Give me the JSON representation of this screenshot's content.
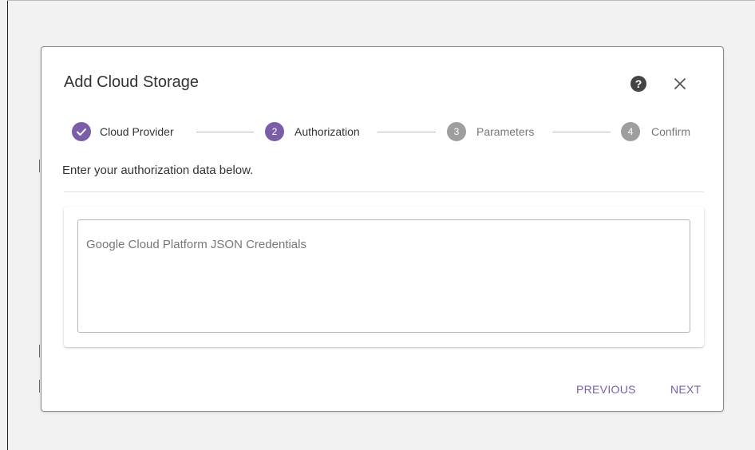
{
  "dialog": {
    "title": "Add Cloud Storage",
    "help_icon_glyph": "?"
  },
  "stepper": {
    "steps": [
      {
        "number": "",
        "label": "Cloud Provider",
        "state": "completed"
      },
      {
        "number": "2",
        "label": "Authorization",
        "state": "active"
      },
      {
        "number": "3",
        "label": "Parameters",
        "state": "pending"
      },
      {
        "number": "4",
        "label": "Confirm",
        "state": "pending"
      }
    ]
  },
  "instruction": "Enter your authorization data below.",
  "credentials": {
    "placeholder": "Google Cloud Platform JSON Credentials",
    "value": ""
  },
  "footer": {
    "previous_label": "PREVIOUS",
    "next_label": "NEXT"
  },
  "colors": {
    "accent": "#7b5ea7",
    "step_pending": "#9e9e9e",
    "text_primary": "#333333",
    "text_muted": "#777777",
    "page_background": "#f2f2f2",
    "dialog_background": "#ffffff"
  },
  "icons": [
    "check-icon",
    "help-icon",
    "close-icon"
  ]
}
